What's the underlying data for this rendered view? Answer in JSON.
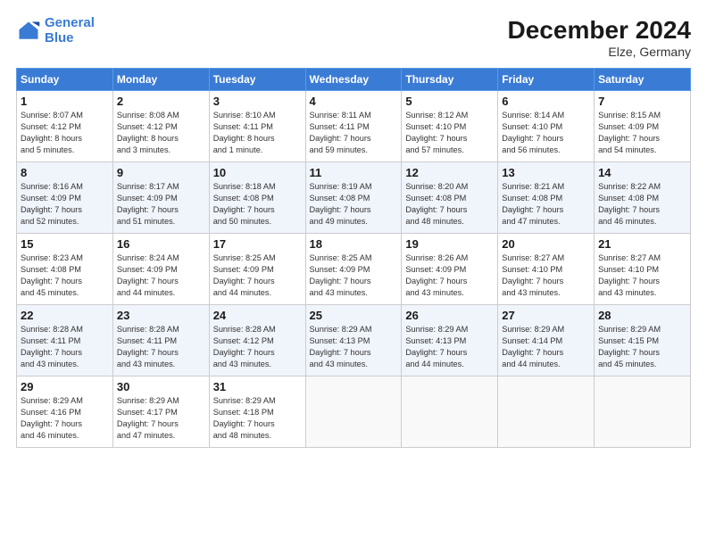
{
  "logo": {
    "line1": "General",
    "line2": "Blue"
  },
  "title": "December 2024",
  "subtitle": "Elze, Germany",
  "header_accent": "#3a7bd5",
  "days_of_week": [
    "Sunday",
    "Monday",
    "Tuesday",
    "Wednesday",
    "Thursday",
    "Friday",
    "Saturday"
  ],
  "weeks": [
    [
      {
        "day": "1",
        "lines": [
          "Sunrise: 8:07 AM",
          "Sunset: 4:12 PM",
          "Daylight: 8 hours",
          "and 5 minutes."
        ]
      },
      {
        "day": "2",
        "lines": [
          "Sunrise: 8:08 AM",
          "Sunset: 4:12 PM",
          "Daylight: 8 hours",
          "and 3 minutes."
        ]
      },
      {
        "day": "3",
        "lines": [
          "Sunrise: 8:10 AM",
          "Sunset: 4:11 PM",
          "Daylight: 8 hours",
          "and 1 minute."
        ]
      },
      {
        "day": "4",
        "lines": [
          "Sunrise: 8:11 AM",
          "Sunset: 4:11 PM",
          "Daylight: 7 hours",
          "and 59 minutes."
        ]
      },
      {
        "day": "5",
        "lines": [
          "Sunrise: 8:12 AM",
          "Sunset: 4:10 PM",
          "Daylight: 7 hours",
          "and 57 minutes."
        ]
      },
      {
        "day": "6",
        "lines": [
          "Sunrise: 8:14 AM",
          "Sunset: 4:10 PM",
          "Daylight: 7 hours",
          "and 56 minutes."
        ]
      },
      {
        "day": "7",
        "lines": [
          "Sunrise: 8:15 AM",
          "Sunset: 4:09 PM",
          "Daylight: 7 hours",
          "and 54 minutes."
        ]
      }
    ],
    [
      {
        "day": "8",
        "lines": [
          "Sunrise: 8:16 AM",
          "Sunset: 4:09 PM",
          "Daylight: 7 hours",
          "and 52 minutes."
        ]
      },
      {
        "day": "9",
        "lines": [
          "Sunrise: 8:17 AM",
          "Sunset: 4:09 PM",
          "Daylight: 7 hours",
          "and 51 minutes."
        ]
      },
      {
        "day": "10",
        "lines": [
          "Sunrise: 8:18 AM",
          "Sunset: 4:08 PM",
          "Daylight: 7 hours",
          "and 50 minutes."
        ]
      },
      {
        "day": "11",
        "lines": [
          "Sunrise: 8:19 AM",
          "Sunset: 4:08 PM",
          "Daylight: 7 hours",
          "and 49 minutes."
        ]
      },
      {
        "day": "12",
        "lines": [
          "Sunrise: 8:20 AM",
          "Sunset: 4:08 PM",
          "Daylight: 7 hours",
          "and 48 minutes."
        ]
      },
      {
        "day": "13",
        "lines": [
          "Sunrise: 8:21 AM",
          "Sunset: 4:08 PM",
          "Daylight: 7 hours",
          "and 47 minutes."
        ]
      },
      {
        "day": "14",
        "lines": [
          "Sunrise: 8:22 AM",
          "Sunset: 4:08 PM",
          "Daylight: 7 hours",
          "and 46 minutes."
        ]
      }
    ],
    [
      {
        "day": "15",
        "lines": [
          "Sunrise: 8:23 AM",
          "Sunset: 4:08 PM",
          "Daylight: 7 hours",
          "and 45 minutes."
        ]
      },
      {
        "day": "16",
        "lines": [
          "Sunrise: 8:24 AM",
          "Sunset: 4:09 PM",
          "Daylight: 7 hours",
          "and 44 minutes."
        ]
      },
      {
        "day": "17",
        "lines": [
          "Sunrise: 8:25 AM",
          "Sunset: 4:09 PM",
          "Daylight: 7 hours",
          "and 44 minutes."
        ]
      },
      {
        "day": "18",
        "lines": [
          "Sunrise: 8:25 AM",
          "Sunset: 4:09 PM",
          "Daylight: 7 hours",
          "and 43 minutes."
        ]
      },
      {
        "day": "19",
        "lines": [
          "Sunrise: 8:26 AM",
          "Sunset: 4:09 PM",
          "Daylight: 7 hours",
          "and 43 minutes."
        ]
      },
      {
        "day": "20",
        "lines": [
          "Sunrise: 8:27 AM",
          "Sunset: 4:10 PM",
          "Daylight: 7 hours",
          "and 43 minutes."
        ]
      },
      {
        "day": "21",
        "lines": [
          "Sunrise: 8:27 AM",
          "Sunset: 4:10 PM",
          "Daylight: 7 hours",
          "and 43 minutes."
        ]
      }
    ],
    [
      {
        "day": "22",
        "lines": [
          "Sunrise: 8:28 AM",
          "Sunset: 4:11 PM",
          "Daylight: 7 hours",
          "and 43 minutes."
        ]
      },
      {
        "day": "23",
        "lines": [
          "Sunrise: 8:28 AM",
          "Sunset: 4:11 PM",
          "Daylight: 7 hours",
          "and 43 minutes."
        ]
      },
      {
        "day": "24",
        "lines": [
          "Sunrise: 8:28 AM",
          "Sunset: 4:12 PM",
          "Daylight: 7 hours",
          "and 43 minutes."
        ]
      },
      {
        "day": "25",
        "lines": [
          "Sunrise: 8:29 AM",
          "Sunset: 4:13 PM",
          "Daylight: 7 hours",
          "and 43 minutes."
        ]
      },
      {
        "day": "26",
        "lines": [
          "Sunrise: 8:29 AM",
          "Sunset: 4:13 PM",
          "Daylight: 7 hours",
          "and 44 minutes."
        ]
      },
      {
        "day": "27",
        "lines": [
          "Sunrise: 8:29 AM",
          "Sunset: 4:14 PM",
          "Daylight: 7 hours",
          "and 44 minutes."
        ]
      },
      {
        "day": "28",
        "lines": [
          "Sunrise: 8:29 AM",
          "Sunset: 4:15 PM",
          "Daylight: 7 hours",
          "and 45 minutes."
        ]
      }
    ],
    [
      {
        "day": "29",
        "lines": [
          "Sunrise: 8:29 AM",
          "Sunset: 4:16 PM",
          "Daylight: 7 hours",
          "and 46 minutes."
        ]
      },
      {
        "day": "30",
        "lines": [
          "Sunrise: 8:29 AM",
          "Sunset: 4:17 PM",
          "Daylight: 7 hours",
          "and 47 minutes."
        ]
      },
      {
        "day": "31",
        "lines": [
          "Sunrise: 8:29 AM",
          "Sunset: 4:18 PM",
          "Daylight: 7 hours",
          "and 48 minutes."
        ]
      },
      null,
      null,
      null,
      null
    ]
  ]
}
